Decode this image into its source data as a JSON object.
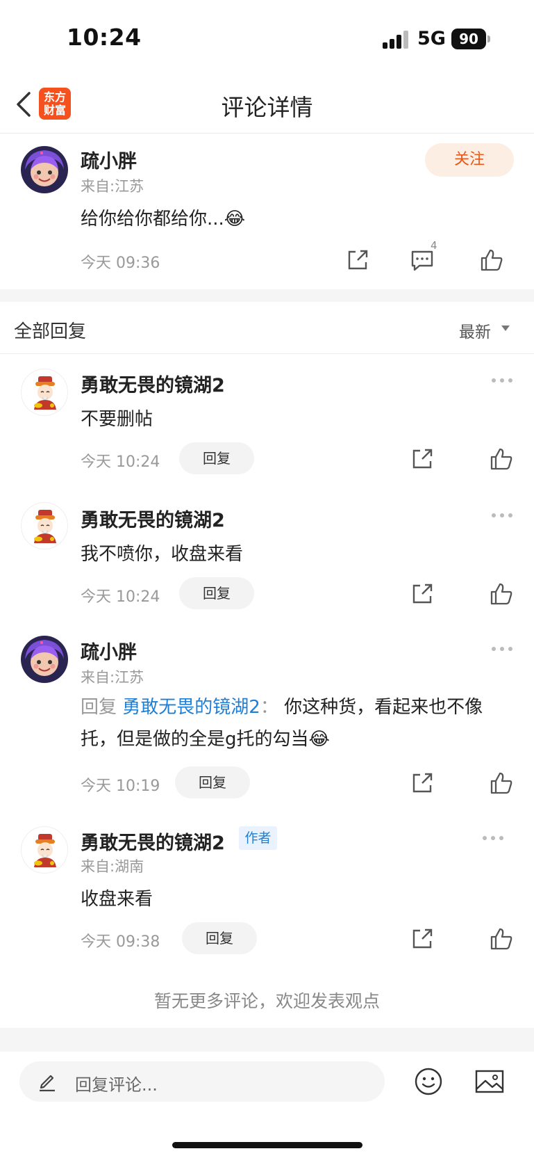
{
  "status_bar": {
    "time": "10:24",
    "network": "5G",
    "battery": "90"
  },
  "header": {
    "title": "评论详情",
    "logo_text": "东方财富"
  },
  "main_comment": {
    "user": "疏小胖",
    "location": "来自:江苏",
    "follow_label": "关注",
    "text": "给你给你都给你...😂",
    "time": "今天 09:36",
    "comment_count": "4"
  },
  "replies_section": {
    "title": "全部回复",
    "sort": "最新"
  },
  "replies": [
    {
      "user": "勇敢无畏的镜湖2",
      "text": "不要删帖",
      "time": "今天 10:24",
      "reply_label": "回复"
    },
    {
      "user": "勇敢无畏的镜湖2",
      "text": "我不喷你，收盘来看",
      "time": "今天 10:24",
      "reply_label": "回复"
    },
    {
      "user": "疏小胖",
      "location": "来自:江苏",
      "reply_prefix": "回复",
      "mention": "勇敢无畏的镜湖2",
      "colon": "：",
      "text": "你这种货，看起来也不像托，但是做的全是g托的勾当😂",
      "time": "今天 10:19",
      "reply_label": "回复"
    },
    {
      "user": "勇敢无畏的镜湖2",
      "badge": "作者",
      "location": "来自:湖南",
      "text": "收盘来看",
      "time": "今天 09:38",
      "reply_label": "回复"
    }
  ],
  "end_note": "暂无更多评论，欢迎发表观点",
  "bottom_bar": {
    "placeholder": "回复评论..."
  }
}
